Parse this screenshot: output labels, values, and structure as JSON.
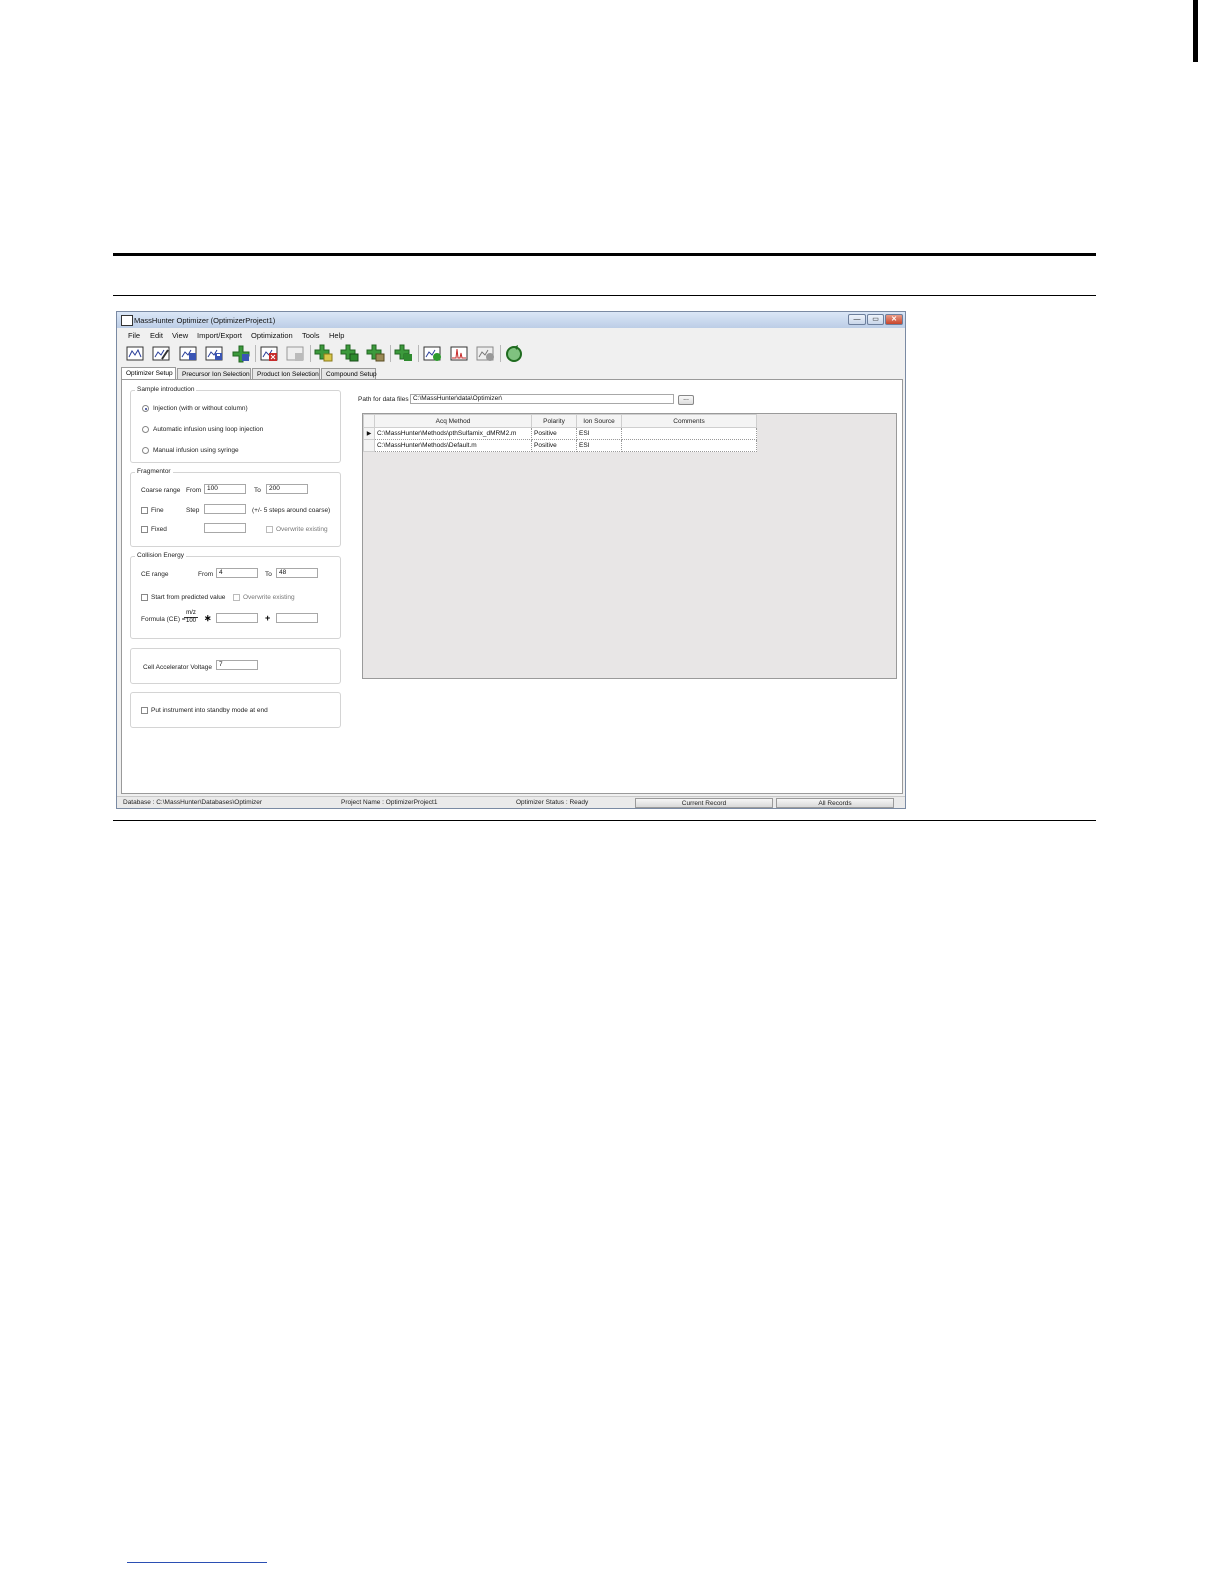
{
  "window": {
    "title": "MassHunter Optimizer (OptimizerProject1)",
    "buttons": {
      "minimize": "—",
      "maximize": "▭",
      "close": "✕"
    }
  },
  "menu": [
    "File",
    "Edit",
    "View",
    "Import/Export",
    "Optimization",
    "Tools",
    "Help"
  ],
  "toolbar_icons": [
    "open-method-icon",
    "edit-method-icon",
    "save-icon",
    "save-as-icon",
    "add-icon",
    "delete-icon",
    "disabled-icon",
    "add-compound-icon",
    "import-compound-icon",
    "edit-compound-icon",
    "transfer-icon",
    "run-icon",
    "spectrum-icon",
    "report-icon",
    "refresh-icon"
  ],
  "tabs": [
    "Optimizer Setup",
    "Precursor Ion Selection",
    "Product Ion Selection",
    "Compound Setup"
  ],
  "sample_introduction": {
    "title": "Sample introduction",
    "options": [
      "Injection (with or without column)",
      "Automatic infusion using loop injection",
      "Manual infusion using syringe"
    ],
    "selected": 0
  },
  "fragmentor": {
    "title": "Fragmentor",
    "coarse_label": "Coarse range",
    "from_label": "From",
    "from_value": "100",
    "to_label": "To",
    "to_value": "200",
    "fine_label": "Fine",
    "step_label": "Step",
    "step_hint": "(+/- 5 steps around coarse)",
    "fixed_label": "Fixed",
    "overwrite_label": "Overwrite existing"
  },
  "collision_energy": {
    "title": "Collision Energy",
    "range_label": "CE range",
    "from_label": "From",
    "from_value": "4",
    "to_label": "To",
    "to_value": "48",
    "predicted_label": "Start from predicted value",
    "overwrite_label": "Overwrite existing",
    "formula_label": "Formula (CE) =",
    "frac_num": "m/z",
    "frac_den": "100",
    "times": "∗",
    "plus": "+"
  },
  "cell_accelerator": {
    "label": "Cell Accelerator Voltage",
    "value": "7"
  },
  "standby": {
    "label": "Put instrument into standby mode at end"
  },
  "data_path": {
    "label": "Path for data files",
    "value": "C:\\MassHunter\\data\\Optimizer\\",
    "browse": "..."
  },
  "methods_table": {
    "columns": [
      "Acq Method",
      "Polarity",
      "Ion Source",
      "Comments"
    ],
    "rows": [
      {
        "method": "C:\\MassHunter\\Methods\\pthSulfamix_dMRM2.m",
        "polarity": "Positive",
        "source": "ESI",
        "comments": ""
      },
      {
        "method": "C:\\MassHunter\\Methods\\Default.m",
        "polarity": "Positive",
        "source": "ESI",
        "comments": ""
      }
    ],
    "current_row_marker": "▶"
  },
  "status": {
    "database": "Database : C:\\MassHunter\\Databases\\Optimizer",
    "project": "Project Name : OptimizerProject1",
    "optimizer_status": "Optimizer Status : Ready",
    "current_record": "Current Record",
    "all_records": "All Records"
  }
}
